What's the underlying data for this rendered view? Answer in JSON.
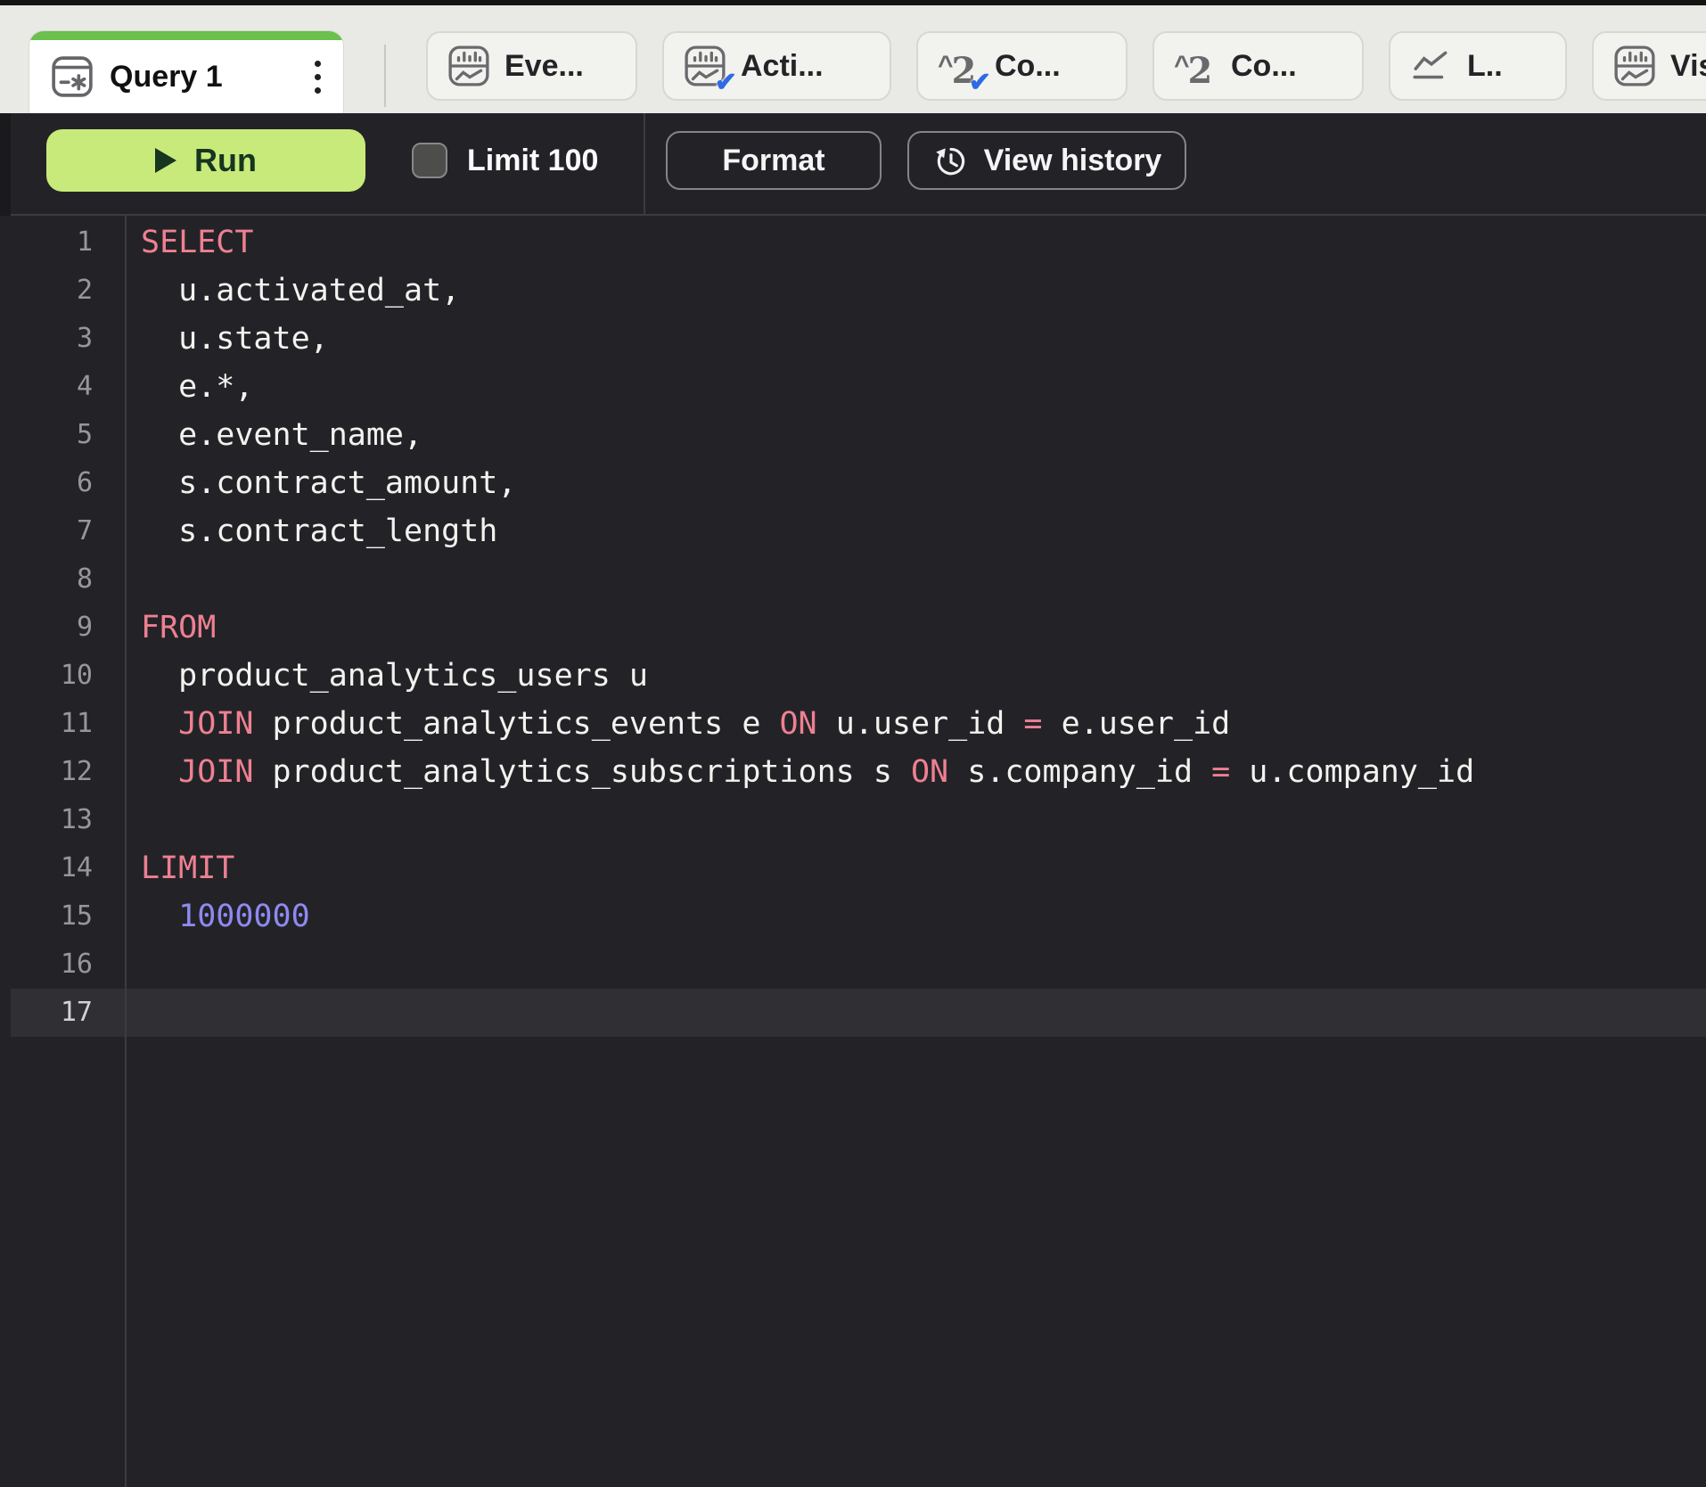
{
  "tab_bar": {
    "tabs": [
      {
        "label": "Query 1",
        "icon": "query-cell-icon",
        "active": true
      },
      {
        "label": "Eve...",
        "icon": "chart-cell-icon",
        "checked": false
      },
      {
        "label": "Acti...",
        "icon": "chart-cell-icon",
        "checked": true
      },
      {
        "label": "Co...",
        "icon": "number-cell-icon",
        "checked": true
      },
      {
        "label": "Co...",
        "icon": "number-cell-icon",
        "checked": false
      },
      {
        "label": "L..",
        "icon": "line-chart-icon",
        "checked": false
      },
      {
        "label": "Vis...",
        "icon": "chart-cell-icon",
        "checked": false
      }
    ]
  },
  "toolbar": {
    "run_label": "Run",
    "limit_label": "Limit 100",
    "limit_checked": false,
    "format_label": "Format",
    "view_history_label": "View history"
  },
  "editor": {
    "language": "sql",
    "active_line": 17,
    "lines": [
      {
        "num": 1,
        "tokens": [
          [
            "SELECT",
            "kw"
          ]
        ]
      },
      {
        "num": 2,
        "tokens": [
          [
            "  u.activated_at,",
            "id"
          ]
        ]
      },
      {
        "num": 3,
        "tokens": [
          [
            "  u.state,",
            "id"
          ]
        ]
      },
      {
        "num": 4,
        "tokens": [
          [
            "  e.*,",
            "id"
          ]
        ]
      },
      {
        "num": 5,
        "tokens": [
          [
            "  e.event_name,",
            "id"
          ]
        ]
      },
      {
        "num": 6,
        "tokens": [
          [
            "  s.contract_amount,",
            "id"
          ]
        ]
      },
      {
        "num": 7,
        "tokens": [
          [
            "  s.contract_length",
            "id"
          ]
        ]
      },
      {
        "num": 8,
        "tokens": []
      },
      {
        "num": 9,
        "tokens": [
          [
            "FROM",
            "kw"
          ]
        ]
      },
      {
        "num": 10,
        "tokens": [
          [
            "  product_analytics_users u",
            "id"
          ]
        ]
      },
      {
        "num": 11,
        "tokens": [
          [
            "  ",
            "id"
          ],
          [
            "JOIN",
            "kw"
          ],
          [
            " product_analytics_events e ",
            "id"
          ],
          [
            "ON",
            "kw"
          ],
          [
            " u.user_id ",
            "id"
          ],
          [
            "=",
            "kw"
          ],
          [
            " e.user_id",
            "id"
          ]
        ]
      },
      {
        "num": 12,
        "tokens": [
          [
            "  ",
            "id"
          ],
          [
            "JOIN",
            "kw"
          ],
          [
            " product_analytics_subscriptions s ",
            "id"
          ],
          [
            "ON",
            "kw"
          ],
          [
            " s.company_id ",
            "id"
          ],
          [
            "=",
            "kw"
          ],
          [
            " u.company_id",
            "id"
          ]
        ]
      },
      {
        "num": 13,
        "tokens": []
      },
      {
        "num": 14,
        "tokens": [
          [
            "LIMIT",
            "kw"
          ]
        ]
      },
      {
        "num": 15,
        "tokens": [
          [
            "  1000000",
            "num"
          ]
        ]
      },
      {
        "num": 16,
        "tokens": []
      },
      {
        "num": 17,
        "tokens": []
      }
    ]
  },
  "colors": {
    "tab_accent_green": "#6cc04d",
    "run_button_green": "#c7ea7a",
    "check_blue": "#2f6ae5",
    "keyword_pink": "#ee8092",
    "number_purple": "#8f89f1",
    "editor_background": "#232327",
    "tabbar_background": "#e9e9e6"
  }
}
